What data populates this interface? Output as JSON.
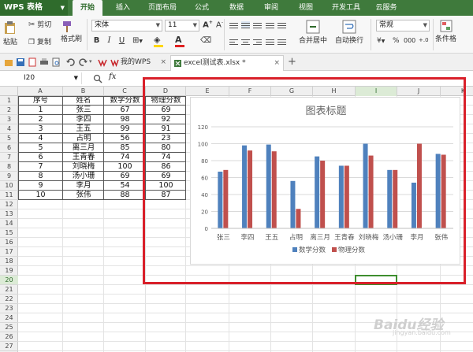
{
  "app": {
    "name": "WPS 表格"
  },
  "ribbon_tabs": [
    "开始",
    "插入",
    "页面布局",
    "公式",
    "数据",
    "审阅",
    "视图",
    "开发工具",
    "云服务"
  ],
  "ribbon": {
    "paste": "粘贴",
    "cut": "剪切",
    "copy": "复制",
    "format_painter": "格式刷",
    "font_name": "宋体",
    "font_size": "11",
    "merge_center": "合并居中",
    "auto_wrap": "自动换行",
    "number_format": "常规",
    "conditional": "条件格"
  },
  "doc_tabs": [
    "我的WPS",
    "excel测试表.xlsx *"
  ],
  "formula_bar": {
    "name_box": "I20",
    "fx": "fx",
    "content": ""
  },
  "columns": [
    "A",
    "B",
    "C",
    "D",
    "E",
    "F",
    "G",
    "H",
    "I",
    "J",
    "K"
  ],
  "selected_column": "I",
  "selected_row": 20,
  "row_count": 27,
  "table": {
    "headers": [
      "序号",
      "姓名",
      "数学分数",
      "物理分数"
    ],
    "rows": [
      [
        "1",
        "张三",
        "67",
        "69"
      ],
      [
        "2",
        "李四",
        "98",
        "92"
      ],
      [
        "3",
        "王五",
        "99",
        "91"
      ],
      [
        "4",
        "占明",
        "56",
        "23"
      ],
      [
        "5",
        "离三月",
        "85",
        "80"
      ],
      [
        "6",
        "王青春",
        "74",
        "74"
      ],
      [
        "7",
        "刘晓梅",
        "100",
        "86"
      ],
      [
        "8",
        "汤小珊",
        "69",
        "69"
      ],
      [
        "9",
        "李月",
        "54",
        "100"
      ],
      [
        "10",
        "张伟",
        "88",
        "87"
      ]
    ]
  },
  "chart_data": {
    "type": "bar",
    "title": "图表标题",
    "categories": [
      "张三",
      "李四",
      "王五",
      "占明",
      "离三月",
      "王青春",
      "刘晓梅",
      "汤小珊",
      "李月",
      "张伟"
    ],
    "series": [
      {
        "name": "数学分数",
        "values": [
          67,
          98,
          99,
          56,
          85,
          74,
          100,
          69,
          54,
          88
        ],
        "color": "#4f81bd"
      },
      {
        "name": "物理分数",
        "values": [
          69,
          92,
          91,
          23,
          80,
          74,
          86,
          69,
          100,
          87
        ],
        "color": "#c0504d"
      }
    ],
    "yticks": [
      0,
      20,
      40,
      60,
      80,
      100,
      120
    ],
    "ylim": [
      0,
      120
    ],
    "grid": true,
    "legend_position": "bottom"
  },
  "watermark": {
    "text": "Baidu经验",
    "sub": "jingyan.baidu.com"
  }
}
